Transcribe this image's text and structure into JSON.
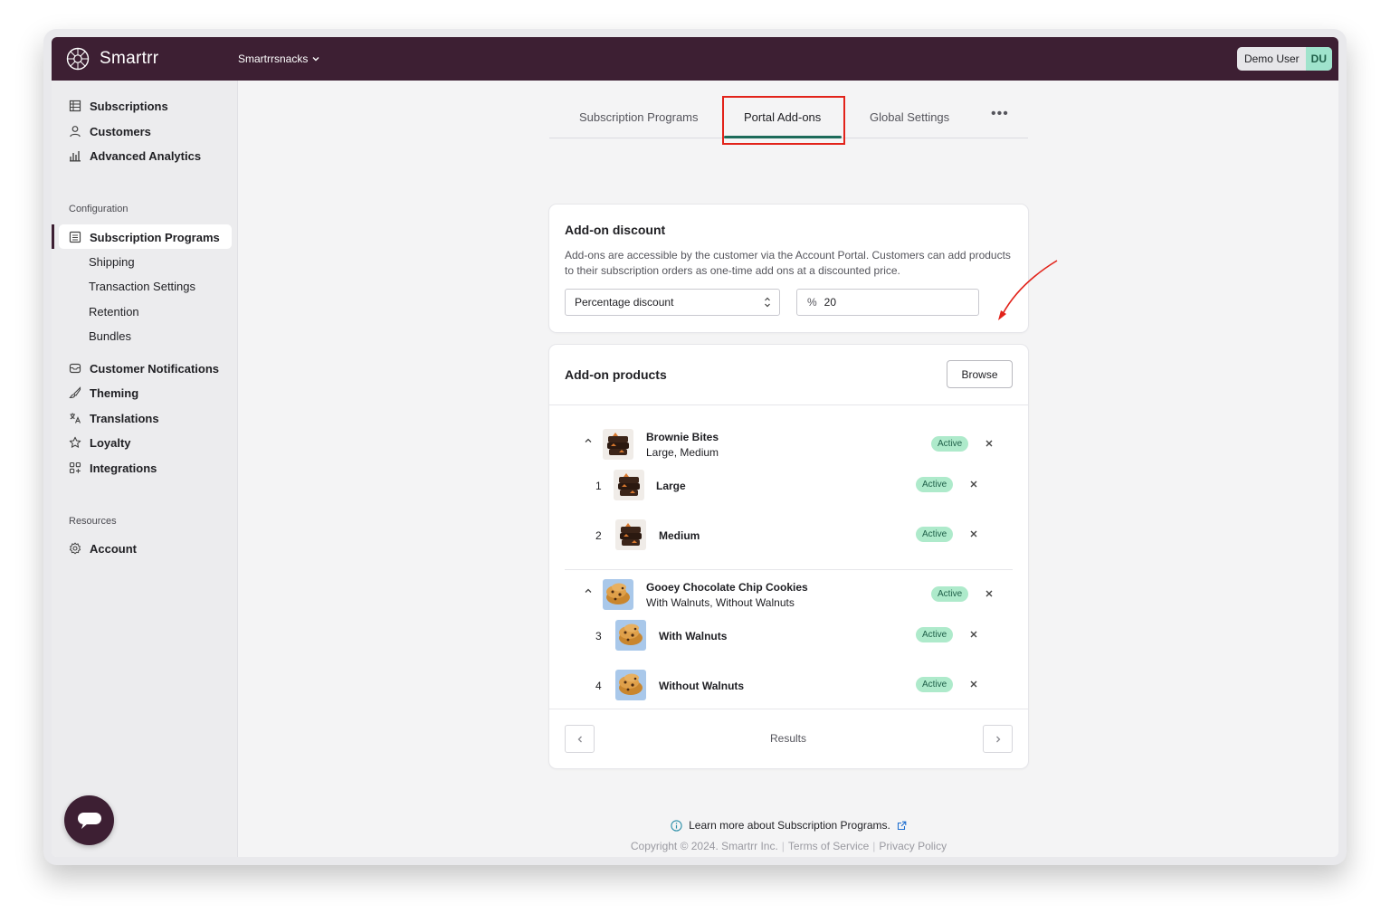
{
  "app": {
    "name": "Smartrr",
    "store": "Smartrrsnacks",
    "user_name": "Demo User",
    "user_initials": "DU"
  },
  "sidebar": {
    "top_items": [
      {
        "label": "Subscriptions",
        "icon": "table-icon"
      },
      {
        "label": "Customers",
        "icon": "person-icon"
      },
      {
        "label": "Advanced Analytics",
        "icon": "bar-chart-icon"
      }
    ],
    "configuration_label": "Configuration",
    "config_items": [
      {
        "label": "Subscription Programs",
        "icon": "list-icon",
        "active": true
      }
    ],
    "sub_items": [
      "Shipping",
      "Transaction Settings",
      "Retention",
      "Bundles"
    ],
    "more_items": [
      {
        "label": "Customer Notifications",
        "icon": "mail-icon"
      },
      {
        "label": "Theming",
        "icon": "brush-icon"
      },
      {
        "label": "Translations",
        "icon": "translate-icon"
      },
      {
        "label": "Loyalty",
        "icon": "star-icon"
      },
      {
        "label": "Integrations",
        "icon": "apps-icon"
      }
    ],
    "resources_label": "Resources",
    "resource_items": [
      {
        "label": "Account",
        "icon": "gear-icon"
      }
    ]
  },
  "tabs": [
    "Subscription Programs",
    "Portal Add-ons",
    "Global Settings"
  ],
  "active_tab": "Portal Add-ons",
  "discount": {
    "title": "Add-on discount",
    "description": "Add-ons are accessible by the customer via the Account Portal. Customers can add products to their subscription orders as one-time add ons at a discounted price.",
    "type": "Percentage discount",
    "prefix": "%",
    "value": "20"
  },
  "products": {
    "title": "Add-on products",
    "browse_label": "Browse",
    "groups": [
      {
        "name": "Brownie Bites",
        "variants_summary": "Large, Medium",
        "status": "Active",
        "variants": [
          {
            "num": "1",
            "name": "Large",
            "status": "Active"
          },
          {
            "num": "2",
            "name": "Medium",
            "status": "Active"
          }
        ]
      },
      {
        "name": "Gooey Chocolate Chip Cookies",
        "variants_summary": "With Walnuts, Without Walnuts",
        "status": "Active",
        "variants": [
          {
            "num": "3",
            "name": "With Walnuts",
            "status": "Active"
          },
          {
            "num": "4",
            "name": "Without Walnuts",
            "status": "Active"
          }
        ]
      }
    ],
    "results_label": "Results"
  },
  "footer": {
    "learn_more": "Learn more about Subscription Programs.",
    "copyright": "Copyright © 2024. Smartrr Inc.",
    "terms": "Terms of Service",
    "privacy": "Privacy Policy"
  },
  "colors": {
    "brand": "#3d1f33",
    "accent": "#1d6b5a",
    "badge_bg": "#aeeacb",
    "annotation_red": "#e2231a"
  }
}
